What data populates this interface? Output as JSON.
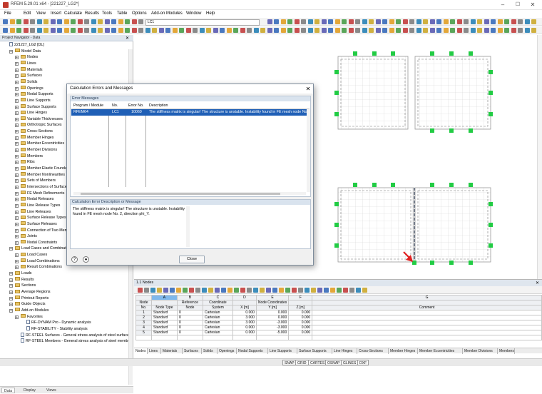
{
  "window": {
    "title": "RFEM 5.29.01 x64 - [221227_LG2*]"
  },
  "menu": [
    "File",
    "Edit",
    "View",
    "Insert",
    "Calculate",
    "Results",
    "Tools",
    "Table",
    "Options",
    "Add-on Modules",
    "Window",
    "Help"
  ],
  "toolbar": {
    "load_case": "LC1"
  },
  "navigator": {
    "title": "Project Navigator - Data",
    "items": [
      {
        "label": "221227_LG2 [DL]",
        "level": 0,
        "icon": "page"
      },
      {
        "label": "Model Data",
        "level": 1,
        "icon": "folder"
      },
      {
        "label": "Nodes",
        "level": 2,
        "icon": "folder"
      },
      {
        "label": "Lines",
        "level": 2,
        "icon": "folder"
      },
      {
        "label": "Materials",
        "level": 2,
        "icon": "folder"
      },
      {
        "label": "Surfaces",
        "level": 2,
        "icon": "folder"
      },
      {
        "label": "Solids",
        "level": 2,
        "icon": "folder"
      },
      {
        "label": "Openings",
        "level": 2,
        "icon": "folder"
      },
      {
        "label": "Nodal Supports",
        "level": 2,
        "icon": "folder"
      },
      {
        "label": "Line Supports",
        "level": 2,
        "icon": "folder"
      },
      {
        "label": "Surface Supports",
        "level": 2,
        "icon": "folder"
      },
      {
        "label": "Line Hinges",
        "level": 2,
        "icon": "folder"
      },
      {
        "label": "Variable Thicknesses",
        "level": 2,
        "icon": "folder"
      },
      {
        "label": "Orthotropic Surfaces",
        "level": 2,
        "icon": "folder"
      },
      {
        "label": "Cross-Sections",
        "level": 2,
        "icon": "folder"
      },
      {
        "label": "Member Hinges",
        "level": 2,
        "icon": "folder"
      },
      {
        "label": "Member Eccentricities",
        "level": 2,
        "icon": "folder"
      },
      {
        "label": "Member Divisions",
        "level": 2,
        "icon": "folder"
      },
      {
        "label": "Members",
        "level": 2,
        "icon": "folder"
      },
      {
        "label": "Ribs",
        "level": 2,
        "icon": "folder"
      },
      {
        "label": "Member Elastic Foundations",
        "level": 2,
        "icon": "folder"
      },
      {
        "label": "Member Nonlinearities",
        "level": 2,
        "icon": "folder"
      },
      {
        "label": "Sets of Members",
        "level": 2,
        "icon": "folder"
      },
      {
        "label": "Intersections of Surfaces",
        "level": 2,
        "icon": "folder"
      },
      {
        "label": "FE Mesh Refinements",
        "level": 2,
        "icon": "folder"
      },
      {
        "label": "Nodal Releases",
        "level": 2,
        "icon": "folder"
      },
      {
        "label": "Line Release Types",
        "level": 2,
        "icon": "folder"
      },
      {
        "label": "Line Releases",
        "level": 2,
        "icon": "folder"
      },
      {
        "label": "Surface Release Types",
        "level": 2,
        "icon": "folder"
      },
      {
        "label": "Surface Releases",
        "level": 2,
        "icon": "folder"
      },
      {
        "label": "Connection of Two Members",
        "level": 2,
        "icon": "folder"
      },
      {
        "label": "Joints",
        "level": 2,
        "icon": "folder"
      },
      {
        "label": "Nodal Constraints",
        "level": 2,
        "icon": "folder"
      },
      {
        "label": "Load Cases and Combinations",
        "level": 1,
        "icon": "folder"
      },
      {
        "label": "Load Cases",
        "level": 2,
        "icon": "folder"
      },
      {
        "label": "Load Combinations",
        "level": 2,
        "icon": "folder"
      },
      {
        "label": "Result Combinations",
        "level": 2,
        "icon": "folder"
      },
      {
        "label": "Loads",
        "level": 1,
        "icon": "folder"
      },
      {
        "label": "Results",
        "level": 1,
        "icon": "folder"
      },
      {
        "label": "Sections",
        "level": 1,
        "icon": "folder"
      },
      {
        "label": "Average Regions",
        "level": 1,
        "icon": "folder"
      },
      {
        "label": "Printout Reports",
        "level": 1,
        "icon": "folder"
      },
      {
        "label": "Guide Objects",
        "level": 1,
        "icon": "folder"
      },
      {
        "label": "Add-on Modules",
        "level": 1,
        "icon": "folder"
      },
      {
        "label": "Favorites",
        "level": 2,
        "icon": "folder"
      },
      {
        "label": "RF-DYNAM Pro - Dynamic analysis",
        "level": 3,
        "icon": "page"
      },
      {
        "label": "RF-STABILITY - Stability analysis",
        "level": 3,
        "icon": "page"
      },
      {
        "label": "RF-STEEL Surfaces - General stress analysis of steel surfaces",
        "level": 2,
        "icon": "page"
      },
      {
        "label": "RF-STEEL Members - General stress analysis of steel members",
        "level": 2,
        "icon": "page"
      }
    ],
    "tabs": [
      "Data",
      "Display",
      "Views"
    ]
  },
  "dialog": {
    "title": "Calculation Errors and Messages",
    "group1": "Error Messages",
    "columns": [
      "Program / Module",
      "No.",
      "Error No.",
      "Description"
    ],
    "row": {
      "program": "RFEM64",
      "no": "LC1",
      "error_no": "10060",
      "description": "The stiffness matrix is singular! The structure is unstable. Instability found in FE mesh node No. 2"
    },
    "group2": "Calculation Error Description or Message",
    "message": "The stiffness matrix is singular! The structure is unstable. Instability found in FE mesh node No. 2, direction phi_Y.",
    "close": "Close"
  },
  "table_panel": {
    "title": "1.1 Nodes",
    "col_letters": [
      "A",
      "B",
      "C",
      "D",
      "E",
      "F",
      "G"
    ],
    "header1": [
      "Node",
      "",
      "Reference",
      "Coordinate",
      "",
      "Node Coordinates",
      "",
      ""
    ],
    "header2": [
      "No.",
      "Node Type",
      "Node",
      "System",
      "X [m]",
      "Y [m]",
      "Z [m]",
      "Comment"
    ],
    "rows": [
      [
        "1",
        "Standard",
        "0",
        "Cartesian",
        "0.000",
        "0.000",
        "0.000",
        ""
      ],
      [
        "2",
        "Standard",
        "0",
        "Cartesian",
        "3.000",
        "0.000",
        "0.000",
        ""
      ],
      [
        "3",
        "Standard",
        "0",
        "Cartesian",
        "3.000",
        "-3.000",
        "0.000",
        ""
      ],
      [
        "4",
        "Standard",
        "0",
        "Cartesian",
        "0.000",
        "-3.000",
        "0.000",
        ""
      ],
      [
        "5",
        "Standard",
        "0",
        "Cartesian",
        "0.000",
        "-5.000",
        "0.000",
        ""
      ]
    ],
    "tabs": [
      "Nodes",
      "Lines",
      "Materials",
      "Surfaces",
      "Solids",
      "Openings",
      "Nodal Supports",
      "Line Supports",
      "Surface Supports",
      "Line Hinges",
      "Cross-Sections",
      "Member Hinges",
      "Member Eccentricities",
      "Member Divisions",
      "Members"
    ]
  },
  "status_bar": [
    "SNAP",
    "GRID",
    "CARTES",
    "OSNAP",
    "GLINES",
    "DXF"
  ],
  "colors": {
    "support": "#22cc44",
    "arrow": "#e02020",
    "grid": "#c8c8c8",
    "selection": "#1f5fb6"
  }
}
